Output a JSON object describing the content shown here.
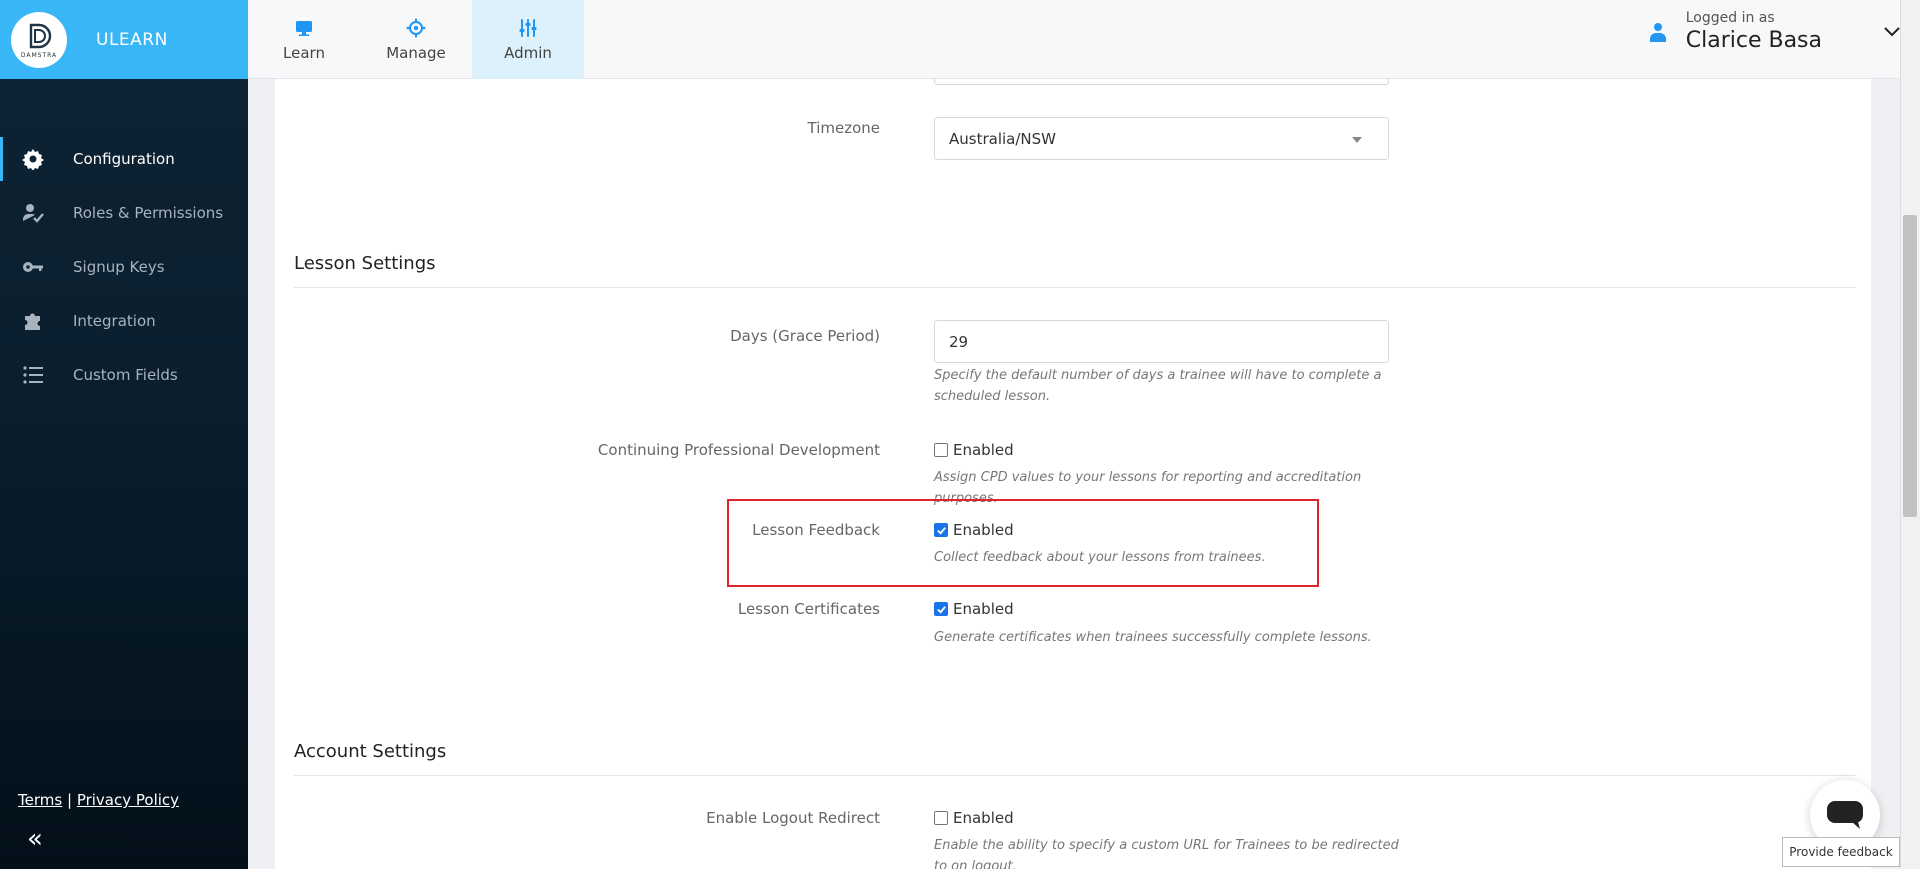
{
  "brand": {
    "logo_text": "DAMSTRA",
    "app_name": "ULEARN",
    "color": "#38b6f6"
  },
  "nav": {
    "tabs": [
      {
        "label": "Learn",
        "icon": "monitor-icon"
      },
      {
        "label": "Manage",
        "icon": "gear-icon"
      },
      {
        "label": "Admin",
        "icon": "sliders-icon",
        "active": true
      }
    ]
  },
  "user": {
    "subtitle": "Logged in as",
    "name": "Clarice Basa"
  },
  "sidebar": {
    "items": [
      {
        "label": "Configuration",
        "icon": "gear-icon",
        "active": true
      },
      {
        "label": "Roles & Permissions",
        "icon": "user-check-icon"
      },
      {
        "label": "Signup Keys",
        "icon": "key-icon"
      },
      {
        "label": "Integration",
        "icon": "puzzle-icon"
      },
      {
        "label": "Custom Fields",
        "icon": "list-icon"
      }
    ],
    "footer": {
      "terms": "Terms",
      "separator": "|",
      "privacy": "Privacy Policy"
    },
    "collapse": "«"
  },
  "form": {
    "timezone": {
      "label": "Timezone",
      "value": "Australia/NSW"
    },
    "lesson_settings": {
      "title": "Lesson Settings",
      "grace_period": {
        "label": "Days (Grace Period)",
        "value": "29",
        "help": "Specify the default number of days a trainee will have to complete a scheduled lesson."
      },
      "cpd": {
        "label": "Continuing Professional Development",
        "checkbox_label": "Enabled",
        "checked": false,
        "help": "Assign CPD values to your lessons for reporting and accreditation purposes."
      },
      "feedback": {
        "label": "Lesson Feedback",
        "checkbox_label": "Enabled",
        "checked": true,
        "help": "Collect feedback about your lessons from trainees."
      },
      "certificates": {
        "label": "Lesson Certificates",
        "checkbox_label": "Enabled",
        "checked": true,
        "help": "Generate certificates when trainees successfully complete lessons."
      }
    },
    "account_settings": {
      "title": "Account Settings",
      "logout_redirect": {
        "label": "Enable Logout Redirect",
        "checkbox_label": "Enabled",
        "checked": false,
        "help": "Enable the ability to specify a custom URL for Trainees to be redirected to on logout."
      }
    }
  },
  "feedback_button": "Provide feedback",
  "colors": {
    "highlight": "#e0242a",
    "checkbox": "#1a73e8"
  }
}
